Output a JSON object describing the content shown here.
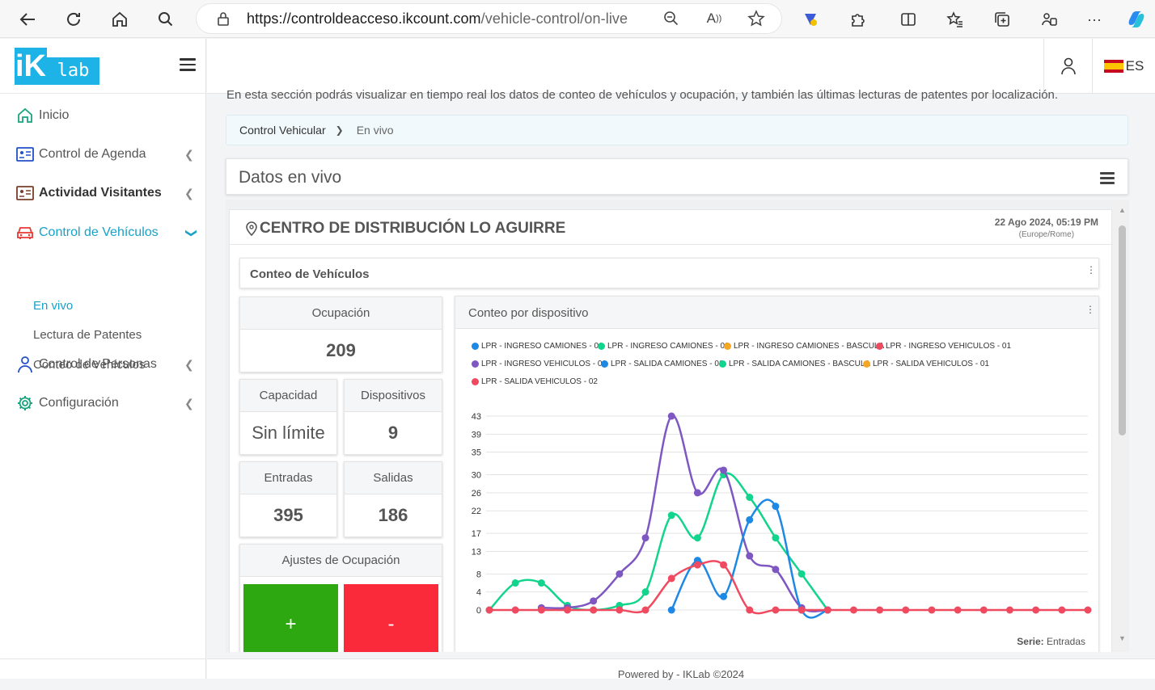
{
  "browser": {
    "url_main": "https://controldeacceso.ikcount.com",
    "url_path": "/vehicle-control/on-live"
  },
  "logo": {
    "ik": "iK",
    "lab": "lab"
  },
  "sidebar": {
    "items": [
      {
        "label": "Inicio"
      },
      {
        "label": "Control de Agenda"
      },
      {
        "label": "Actividad Visitantes"
      },
      {
        "label": "Control de Vehículos"
      },
      {
        "label": "Control de Personas"
      },
      {
        "label": "Configuración"
      }
    ],
    "subitems": [
      {
        "label": "En vivo"
      },
      {
        "label": "Lectura de Patentes"
      },
      {
        "label": "Conteo de Vehículos"
      }
    ]
  },
  "topbar": {
    "lang": "ES"
  },
  "page": {
    "description": "En esta sección podrás visualizar en tiempo real los datos de conteo de vehículos y ocupación, y también las últimas lecturas de patentes por localización.",
    "breadcrumb_root": "Control Vehicular",
    "breadcrumb_current": "En vivo",
    "panel_title": "Datos en vivo",
    "location": "CENTRO DE DISTRIBUCIÓN LO AGUIRRE",
    "date": "22 Ago 2024, 05:19 PM",
    "timezone": "(Europe/Rome)",
    "conteo_title": "Conteo de Vehículos",
    "chart_title": "Conteo por dispositivo",
    "serie_label": "Serie:",
    "serie_value": "Entradas",
    "footer": "Powered by - IKLab ©2024"
  },
  "stats": {
    "ocupacion_label": "Ocupación",
    "ocupacion_value": "209",
    "capacidad_label": "Capacidad",
    "capacidad_value": "Sin límite",
    "dispositivos_label": "Dispositivos",
    "dispositivos_value": "9",
    "entradas_label": "Entradas",
    "entradas_value": "395",
    "salidas_label": "Salidas",
    "salidas_value": "186",
    "ajustes_label": "Ajustes de Ocupación",
    "plus": "+",
    "minus": "-"
  },
  "colors": {
    "accent": "#1db3e6",
    "active_nav": "#17a2c8",
    "green_btn": "#2ea811",
    "red_btn": "#fb2a3a"
  },
  "chart_data": {
    "type": "line",
    "title": "Conteo por dispositivo",
    "yticks": [
      0,
      4,
      8,
      13,
      17,
      22,
      26,
      30,
      35,
      39,
      43
    ],
    "ylim": [
      0,
      43
    ],
    "x_count": 24,
    "legend_placement": "top",
    "grid": true,
    "series": [
      {
        "name": "LPR - INGRESO CAMIONES - 01",
        "color": "#1e88e5",
        "values": [
          null,
          null,
          null,
          null,
          null,
          null,
          null,
          0,
          11,
          3,
          20,
          23,
          0,
          0,
          null,
          null,
          null,
          null,
          null,
          null,
          null,
          null,
          null,
          null
        ]
      },
      {
        "name": "LPR - INGRESO CAMIONES - 02",
        "color": "#12d48c",
        "values": [
          0,
          6,
          6,
          1,
          0,
          1,
          4,
          21,
          16,
          30,
          25,
          16,
          8,
          0,
          null,
          null,
          null,
          null,
          null,
          null,
          null,
          null,
          null,
          null
        ]
      },
      {
        "name": "LPR - INGRESO CAMIONES - BASCULA",
        "color": "#f5a623",
        "values": []
      },
      {
        "name": "LPR - INGRESO VEHICULOS - 01",
        "color": "#ef4a5f",
        "values": [
          0,
          0,
          0,
          0,
          0,
          0,
          0,
          7,
          10,
          10,
          0,
          0,
          0,
          0,
          0,
          0,
          0,
          0,
          0,
          0,
          0,
          0,
          0,
          0
        ]
      },
      {
        "name": "LPR - INGRESO VEHICULOS - 02",
        "color": "#7e57c2",
        "values": [
          null,
          null,
          0.5,
          0.5,
          2,
          8,
          16,
          43,
          26,
          31,
          12,
          9,
          0.5,
          0,
          null,
          null,
          null,
          null,
          null,
          null,
          null,
          null,
          null,
          null
        ]
      },
      {
        "name": "LPR - SALIDA CAMIONES - 01",
        "color": "#1e88e5",
        "values": []
      },
      {
        "name": "LPR - SALIDA CAMIONES - BASCULA",
        "color": "#12d48c",
        "values": []
      },
      {
        "name": "LPR - SALIDA VEHICULOS - 01",
        "color": "#f5a623",
        "values": []
      },
      {
        "name": "LPR - SALIDA VEHICULOS - 02",
        "color": "#ef4a5f",
        "values": []
      }
    ]
  }
}
